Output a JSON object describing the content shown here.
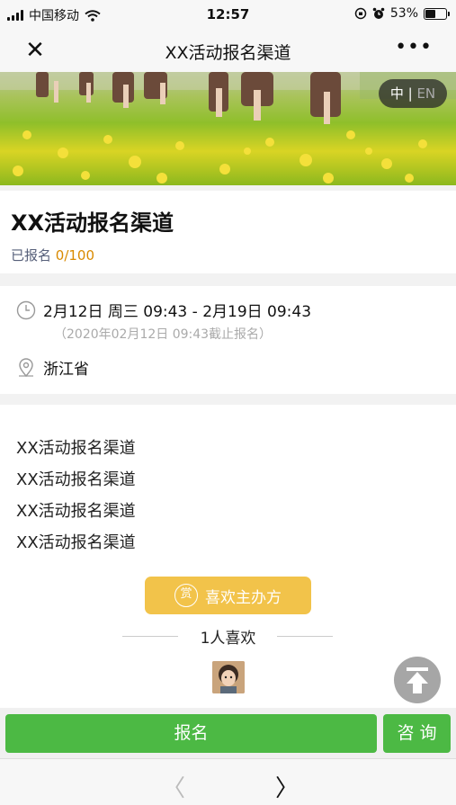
{
  "status_bar": {
    "carrier": "中国移动",
    "time": "12:57",
    "battery": "53%",
    "battery_level": 0.53
  },
  "nav_bar": {
    "close_glyph": "✕",
    "title": "XX活动报名渠道",
    "more_glyph": "•••"
  },
  "banner": {
    "lang_zh": "中",
    "lang_sep": " | ",
    "lang_en": "EN"
  },
  "event": {
    "title": "XX活动报名渠道",
    "registered_label": "已报名 ",
    "registered_count": "0/100",
    "date_range": "2月12日 周三 09:43 - 2月19日 09:43",
    "deadline": "（2020年02月12日 09:43截止报名）",
    "location": "浙江省"
  },
  "description": {
    "lines": [
      "XX活动报名渠道",
      "XX活动报名渠道",
      "XX活动报名渠道",
      "XX活动报名渠道"
    ]
  },
  "like": {
    "reward_glyph": "赏",
    "button_label": "喜欢主办方",
    "likes_label": "1人喜欢"
  },
  "actions": {
    "register_label": "报名",
    "consult_label": "咨询"
  },
  "browser_nav": {
    "back_glyph": "〈",
    "forward_glyph": "〉"
  },
  "colors": {
    "primary_green": "#4cb944",
    "like_yellow": "#f2c34a",
    "count_orange": "#d98a00"
  }
}
